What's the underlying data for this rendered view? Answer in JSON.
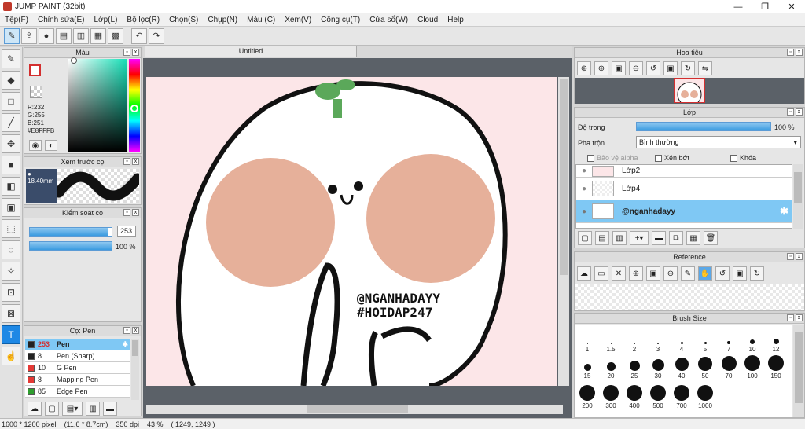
{
  "window": {
    "title": "JUMP PAINT (32bit)"
  },
  "menu": [
    "Tệp(F)",
    "Chỉnh sửa(E)",
    "Lớp(L)",
    "Bộ lọc(R)",
    "Chọn(S)",
    "Chụp(N)",
    "Màu (C)",
    "Xem(V)",
    "Công cụ(T)",
    "Cửa sổ(W)",
    "Cloud",
    "Help"
  ],
  "color_panel": {
    "title": "Màu",
    "r": "R:232",
    "g": "G:255",
    "b": "B:251",
    "hex": "#E8FFFB"
  },
  "preview_panel": {
    "title": "Xem trước cọ",
    "size": "18.40mm"
  },
  "control_panel": {
    "title": "Kiểm soát cọ",
    "size_value": "253",
    "opacity_value": "100 %",
    "size_fraction": 0.96,
    "opacity_fraction": 1.0
  },
  "brush_panel": {
    "title": "Cọ: Pen",
    "items": [
      {
        "size": "253",
        "name": "Pen",
        "color": "#222222"
      },
      {
        "size": "8",
        "name": "Pen (Sharp)",
        "color": "#222222"
      },
      {
        "size": "10",
        "name": "G Pen",
        "color": "#e53935"
      },
      {
        "size": "8",
        "name": "Mapping Pen",
        "color": "#e53935"
      },
      {
        "size": "85",
        "name": "Edge Pen",
        "color": "#2e9e2e"
      }
    ]
  },
  "document": {
    "tab": "Untitled",
    "watermark1": "@NGANHADAYY",
    "watermark2": "#HOIDAP247"
  },
  "navigator": {
    "title": "Hoa tiêu"
  },
  "layer_panel": {
    "title": "Lớp",
    "opacity_label": "Độ trong",
    "opacity_value": "100 %",
    "blend_label": "Pha trộn",
    "blend_value": "Bình thường",
    "protect_alpha": "Bảo vệ alpha",
    "clipping": "Xén bớt",
    "lock": "Khóa",
    "layers": [
      {
        "name": "Lớp2"
      },
      {
        "name": "Lớp4"
      },
      {
        "name": "@nganhadayy"
      }
    ]
  },
  "reference_panel": {
    "title": "Reference"
  },
  "brush_size_panel": {
    "title": "Brush Size",
    "row1": [
      "1",
      "1.5",
      "2",
      "3",
      "4",
      "5",
      "7",
      "10",
      "12"
    ],
    "row2": [
      "15",
      "20",
      "25",
      "30",
      "40",
      "50",
      "70",
      "100",
      "150"
    ],
    "row3": [
      "200",
      "300",
      "400",
      "500",
      "700",
      "1000"
    ]
  },
  "status": {
    "pixels": "1600 * 1200 pixel",
    "size": "(11.6 * 8.7cm)",
    "dpi": "350 dpi",
    "zoom": "43 %",
    "coords": "( 1249, 1249 )"
  },
  "colors": {
    "accent": "#7fc8f4",
    "canvas_bg": "#fce6e8",
    "cheek": "#e6b09a",
    "leaf": "#5ba85a"
  }
}
